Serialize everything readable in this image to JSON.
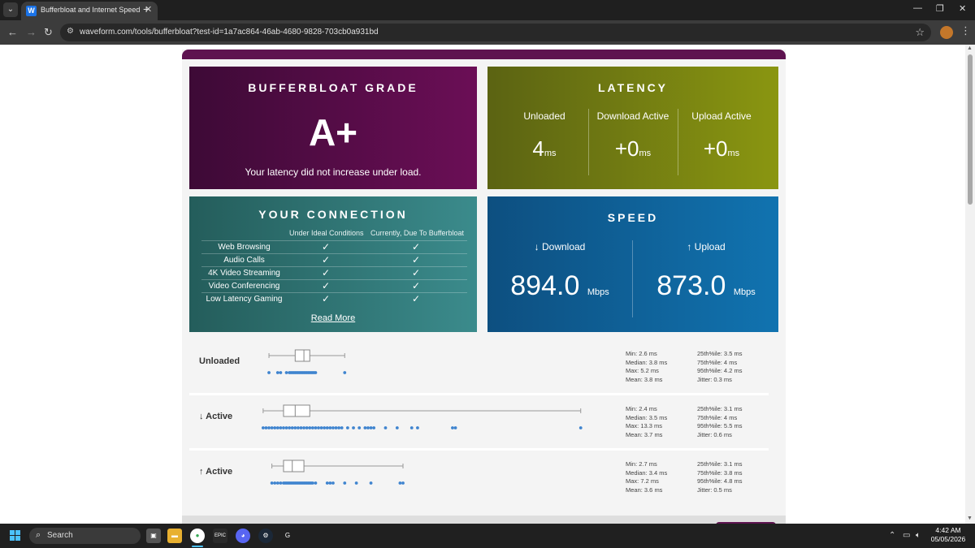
{
  "browser": {
    "tab_title": "Bufferbloat and Internet Speed",
    "tab_favicon": "W",
    "url": "waveform.com/tools/bufferbloat?test-id=1a7ac864-46ab-4680-9828-703cb0a931bd"
  },
  "grade": {
    "title": "BUFFERBLOAT GRADE",
    "value": "A+",
    "message": "Your latency did not increase under load."
  },
  "latency": {
    "title": "LATENCY",
    "unit": "ms",
    "columns": [
      {
        "label": "Unloaded",
        "value": "4"
      },
      {
        "label": "Download Active",
        "value": "+0"
      },
      {
        "label": "Upload Active",
        "value": "+0"
      }
    ]
  },
  "connection": {
    "title": "YOUR CONNECTION",
    "col_ideal": "Under Ideal Conditions",
    "col_current": "Currently, Due To Bufferbloat",
    "check": "✓",
    "rows": [
      {
        "label": "Web Browsing"
      },
      {
        "label": "Audio Calls"
      },
      {
        "label": "4K Video Streaming"
      },
      {
        "label": "Video Conferencing"
      },
      {
        "label": "Low Latency Gaming"
      }
    ],
    "read_more": "Read More"
  },
  "speed": {
    "title": "SPEED",
    "unit": "Mbps",
    "download": {
      "label": "↓ Download",
      "value": "894.0"
    },
    "upload": {
      "label": "↑ Upload",
      "value": "873.0"
    }
  },
  "distributions": [
    {
      "label": "Unloaded",
      "box": {
        "whisker_lo": 2.6,
        "q1": 3.5,
        "median": 3.8,
        "q3": 4.0,
        "whisker_hi": 5.2
      },
      "points": [
        2.6,
        2.9,
        3.0,
        3.2,
        3.3,
        3.35,
        3.4,
        3.45,
        3.5,
        3.55,
        3.6,
        3.65,
        3.7,
        3.75,
        3.8,
        3.85,
        3.9,
        3.95,
        4.0,
        4.05,
        4.1,
        4.15,
        4.2,
        5.2
      ],
      "stats_left": [
        "Min: 2.6 ms",
        "Median: 3.8 ms",
        "Max: 5.2 ms",
        "Mean: 3.8 ms"
      ],
      "stats_right": [
        "25th%ile: 3.5 ms",
        "75th%ile: 4 ms",
        "95th%ile: 4.2 ms",
        "Jitter: 0.3 ms"
      ]
    },
    {
      "label": "↓ Active",
      "box": {
        "whisker_lo": 2.4,
        "q1": 3.1,
        "median": 3.5,
        "q3": 4.0,
        "whisker_hi": 13.3
      },
      "points": [
        2.4,
        2.5,
        2.6,
        2.7,
        2.8,
        2.9,
        3.0,
        3.1,
        3.2,
        3.3,
        3.4,
        3.5,
        3.6,
        3.7,
        3.8,
        3.9,
        4.0,
        4.1,
        4.2,
        4.3,
        4.4,
        4.5,
        4.6,
        4.7,
        4.8,
        4.9,
        5.0,
        5.1,
        5.3,
        5.5,
        5.7,
        5.9,
        6.0,
        6.1,
        6.2,
        6.6,
        7.0,
        7.5,
        7.7,
        8.9,
        9.0,
        13.3
      ],
      "stats_left": [
        "Min: 2.4 ms",
        "Median: 3.5 ms",
        "Max: 13.3 ms",
        "Mean: 3.7 ms"
      ],
      "stats_right": [
        "25th%ile: 3.1 ms",
        "75th%ile: 4 ms",
        "95th%ile: 5.5 ms",
        "Jitter: 0.6 ms"
      ]
    },
    {
      "label": "↑ Active",
      "box": {
        "whisker_lo": 2.7,
        "q1": 3.1,
        "median": 3.4,
        "q3": 3.8,
        "whisker_hi": 7.2
      },
      "points": [
        2.7,
        2.8,
        2.9,
        3.0,
        3.1,
        3.15,
        3.2,
        3.25,
        3.3,
        3.35,
        3.4,
        3.45,
        3.5,
        3.55,
        3.6,
        3.65,
        3.7,
        3.75,
        3.8,
        3.85,
        3.9,
        3.95,
        4.0,
        4.05,
        4.1,
        4.2,
        4.6,
        4.7,
        4.8,
        5.2,
        5.6,
        6.1,
        7.1,
        7.2
      ],
      "stats_left": [
        "Min: 2.7 ms",
        "Median: 3.4 ms",
        "Max: 7.2 ms",
        "Mean: 3.6 ms"
      ],
      "stats_right": [
        "25th%ile: 3.1 ms",
        "75th%ile: 3.8 ms",
        "95th%ile: 4.8 ms",
        "Jitter: 0.5 ms"
      ]
    }
  ],
  "taskbar": {
    "search_label": "Search",
    "time": "4:42 AM",
    "date": "05/05/2026",
    "epic_label": "EPIC"
  },
  "colors": {
    "grade_bg": "#6b0e56",
    "latency_bg": "#8a9611",
    "connection_bg": "#3b8b8c",
    "speed_bg": "#1173b0",
    "dot": "#3f84cf"
  }
}
